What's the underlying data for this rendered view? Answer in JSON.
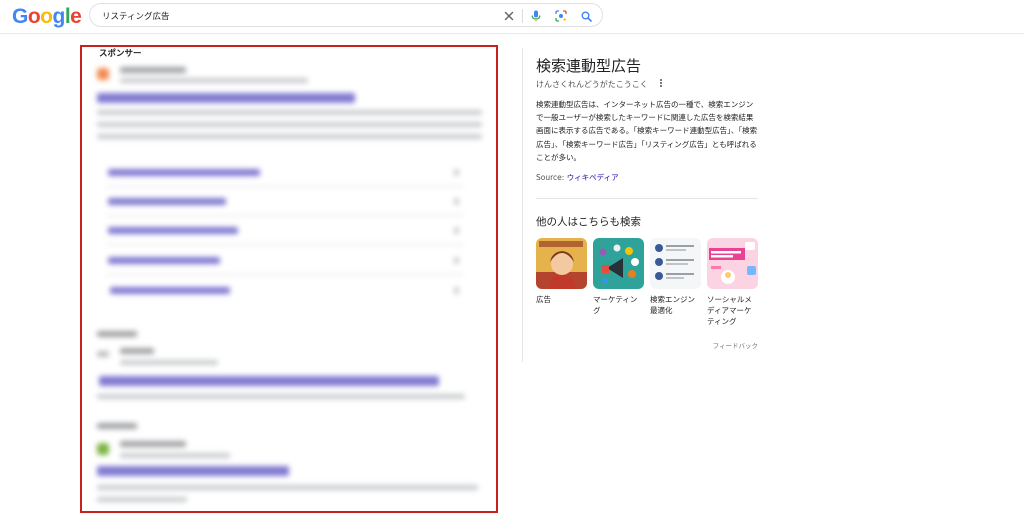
{
  "logo": {
    "letters": [
      "G",
      "o",
      "o",
      "g",
      "l",
      "e"
    ]
  },
  "search": {
    "query": "リスティング広告"
  },
  "icons": {
    "clear": "close-icon",
    "voice": "microphone-icon",
    "lens": "lens-camera-icon",
    "search": "search-icon"
  },
  "ads": {
    "sponsor_label": "スポンサー",
    "frame_color": "#c5221f"
  },
  "knowledge_panel": {
    "title": "検索連動型広告",
    "reading": "けんさくれんどうがたこうこく",
    "description": "検索連動型広告は、インターネット広告の一種で、検索エンジンで一般ユーザーが検索したキーワードに関連した広告を検索結果画面に表示する広告である。「検索キーワード連動型広告」、「検索広告」、「検索キーワード広告」「リスティング広告」とも呼ばれることが多い。",
    "source_label": "Source:",
    "source_link": "ウィキペディア",
    "related_heading": "他の人はこちらも検索",
    "related": [
      {
        "label": "広告"
      },
      {
        "label": "マーケティング"
      },
      {
        "label": "検索エンジン最適化"
      },
      {
        "label": "ソーシャルメディアマーケティング"
      }
    ],
    "feedback": "フィードバック"
  }
}
